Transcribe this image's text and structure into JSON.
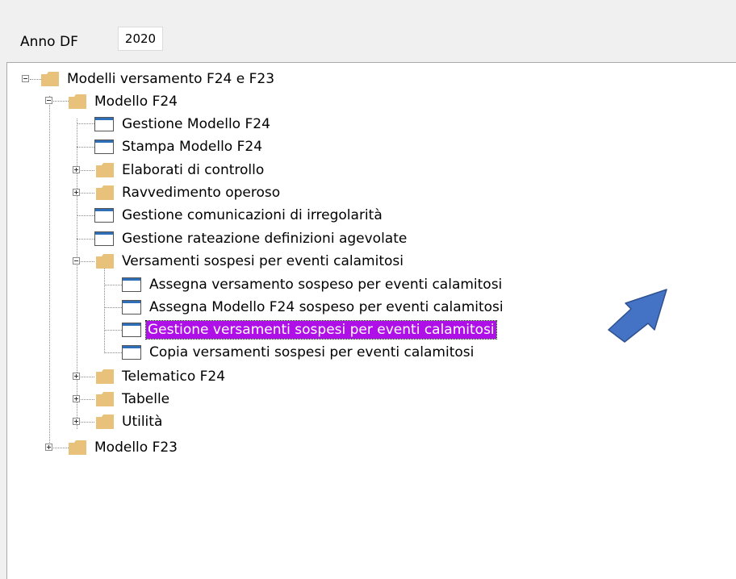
{
  "filter": {
    "label": "Anno DF",
    "year": "2020"
  },
  "tree": {
    "root": "Modelli versamento F24 e F23",
    "modello_f24": {
      "label": "Modello F24",
      "items": [
        "Gestione Modello F24",
        "Stampa Modello F24",
        "Elaborati di controllo",
        "Ravvedimento operoso",
        "Gestione comunicazioni di irregolarità",
        "Gestione rateazione definizioni agevolate",
        "Versamenti sospesi per eventi calamitosi"
      ],
      "sospesi_children": [
        "Assegna versamento sospeso per eventi calamitosi",
        "Assegna Modello F24 sospeso per eventi calamitosi",
        "Gestione versamenti sospesi per eventi calamitosi",
        "Copia versamenti sospesi per eventi calamitosi"
      ],
      "tail_items": [
        "Telematico F24",
        "Tabelle",
        "Utilità"
      ]
    },
    "modello_f23": "Modello F23",
    "selected_item": "Gestione versamenti sospesi per eventi calamitosi"
  },
  "colors": {
    "selection": "#b010e8",
    "arrow": "#4472c4",
    "folder": "#e8c27a",
    "doc_bar": "#2e6fb8"
  },
  "icons": {
    "folder": "folder-icon",
    "document": "document-icon",
    "arrow": "arrow-pointer-icon"
  }
}
